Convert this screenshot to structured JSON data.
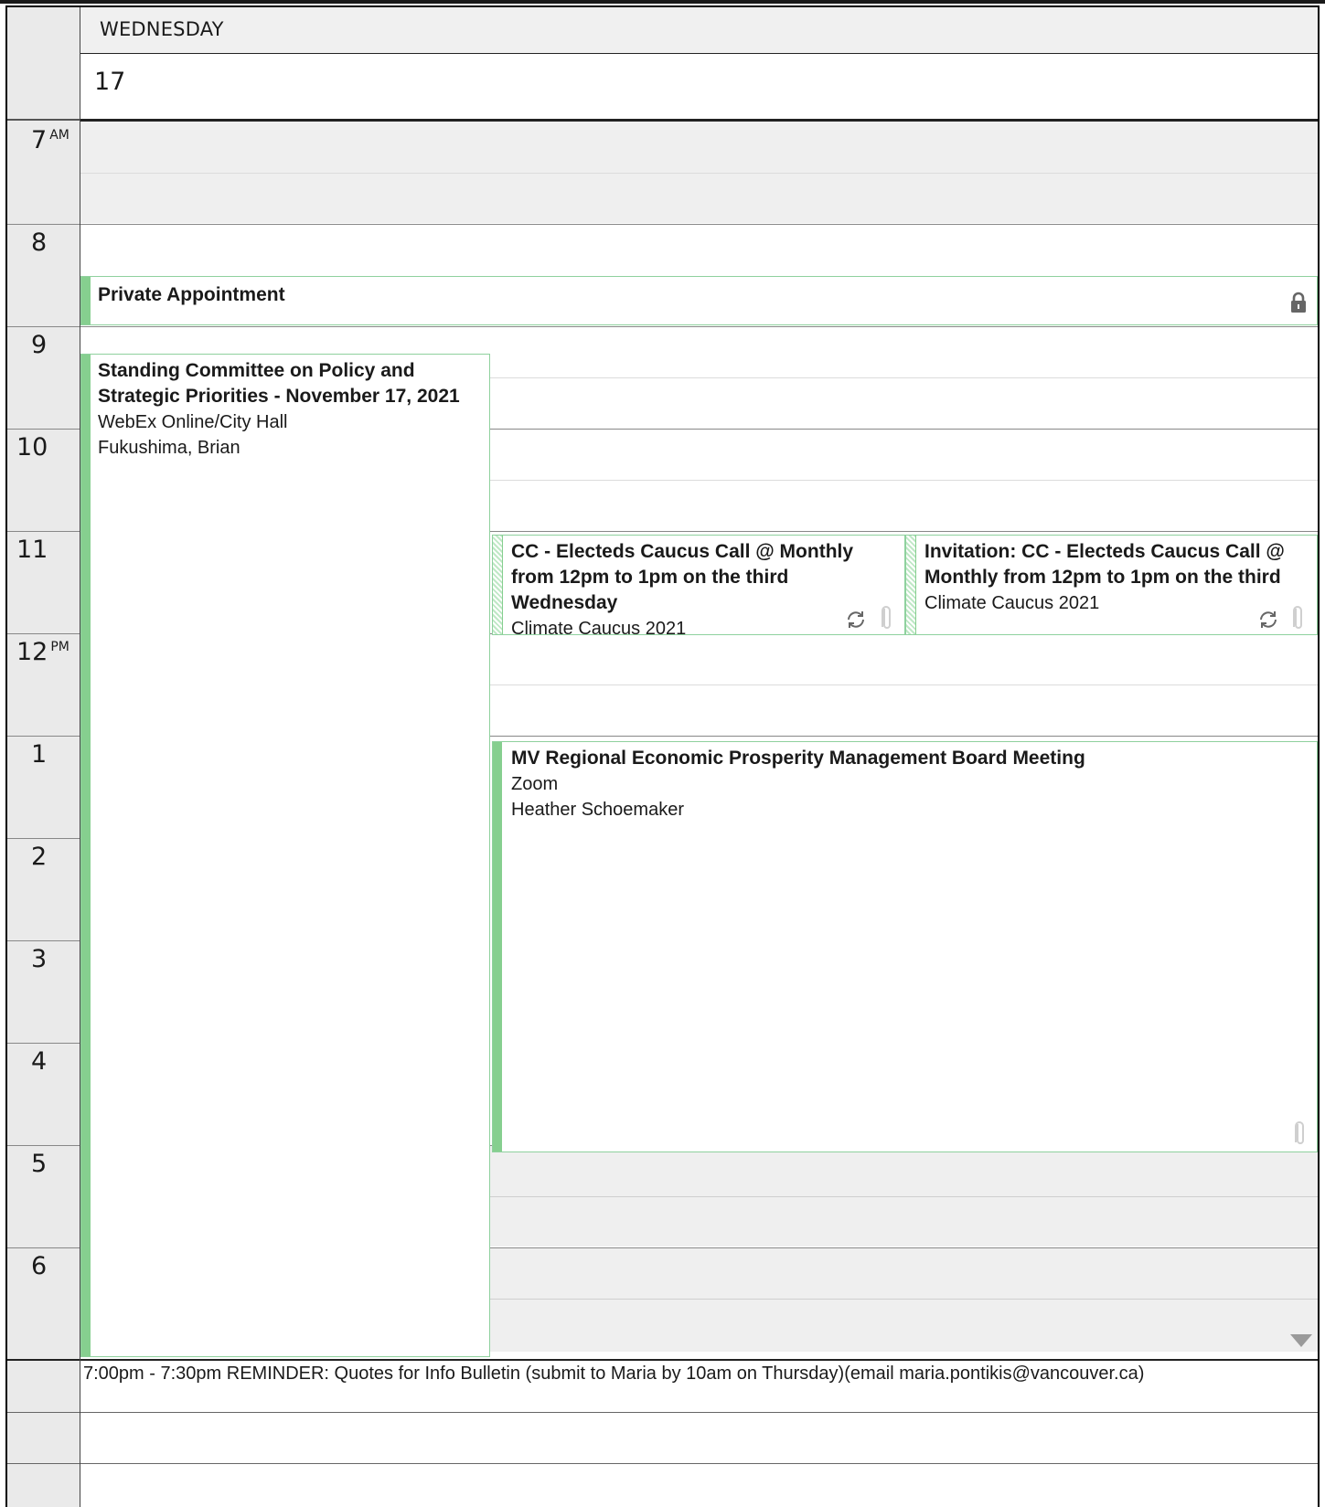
{
  "header": {
    "day_name": "WEDNESDAY",
    "day_number": "17"
  },
  "hours": [
    {
      "label": "7",
      "suffix": "AM"
    },
    {
      "label": "8",
      "suffix": ""
    },
    {
      "label": "9",
      "suffix": ""
    },
    {
      "label": "10",
      "suffix": ""
    },
    {
      "label": "11",
      "suffix": ""
    },
    {
      "label": "12",
      "suffix": "PM"
    },
    {
      "label": "1",
      "suffix": ""
    },
    {
      "label": "2",
      "suffix": ""
    },
    {
      "label": "3",
      "suffix": ""
    },
    {
      "label": "4",
      "suffix": ""
    },
    {
      "label": "5",
      "suffix": ""
    },
    {
      "label": "6",
      "suffix": ""
    }
  ],
  "events": {
    "private": {
      "title": "Private Appointment",
      "icon": "lock-icon"
    },
    "committee": {
      "title": "Standing Committee on Policy and Strategic Priorities - November 17, 2021",
      "location": "WebEx Online/City Hall",
      "organizer": "Fukushima, Brian"
    },
    "caucus": {
      "title": "CC - Electeds Caucus Call @ Monthly from 12pm to 1pm on the third Wednesday",
      "location": "Climate Caucus 2021",
      "icons": [
        "recurring-icon",
        "attachment-icon"
      ]
    },
    "caucus_invite": {
      "title": "Invitation: CC - Electeds Caucus Call @ Monthly from 12pm to 1pm on the third",
      "location": "Climate Caucus 2021",
      "icons": [
        "recurring-icon",
        "attachment-icon"
      ]
    },
    "mv_board": {
      "title": "MV Regional Economic Prosperity Management Board Meeting",
      "location": "Zoom",
      "organizer": "Heather Schoemaker",
      "icons": [
        "attachment-icon"
      ]
    }
  },
  "all_day": {
    "reminder": "7:00pm - 7:30pm REMINDER: Quotes for Info Bulletin (submit to Maria by 10am on Thursday)(email maria.pontikis@vancouver.ca)"
  },
  "colors": {
    "event_accent": "#86cf8f",
    "event_border": "#8fd19e",
    "off_hours": "#efefef",
    "gutter": "#eaeaea"
  }
}
